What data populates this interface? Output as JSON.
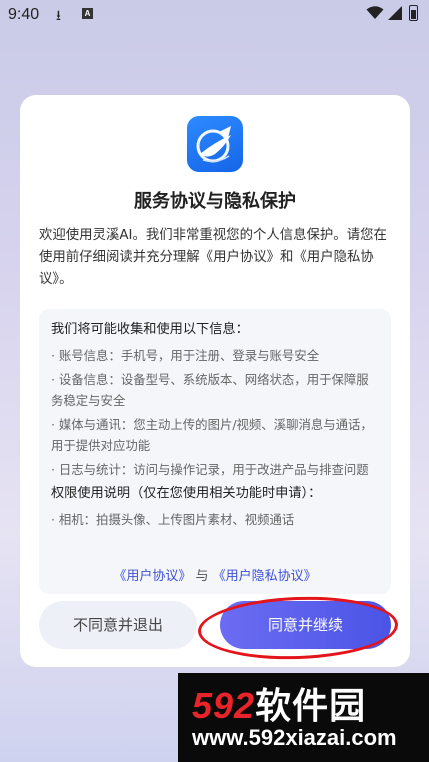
{
  "status_bar": {
    "time": "9:40",
    "indicator_letter": "A"
  },
  "dialog": {
    "title": "服务协议与隐私保护",
    "intro": "欢迎使用灵溪AI。我们非常重视您的个人信息保护。请您在使用前仔细阅读并充分理解《用户协议》和《用户隐私协议》。",
    "info_heading": "我们将可能收集和使用以下信息：",
    "info_items": [
      "· 账号信息：手机号，用于注册、登录与账号安全",
      "· 设备信息：设备型号、系统版本、网络状态，用于保障服务稳定与安全",
      "· 媒体与通讯：您主动上传的图片/视频、溪聊消息与通话，用于提供对应功能",
      "· 日志与统计：访问与操作记录，用于改进产品与排查问题"
    ],
    "permission_heading": "权限使用说明（仅在您使用相关功能时申请）：",
    "permission_items": [
      "· 相机：拍摄头像、上传图片素材、视频通话"
    ],
    "link_user_agreement": "《用户协议》",
    "link_separator": "与",
    "link_privacy_agreement": "《用户隐私协议》",
    "decline_button": "不同意并退出",
    "accept_button": "同意并继续"
  },
  "watermark": {
    "number": "592",
    "name": "软件园",
    "url": "www.592xiazai.com"
  },
  "colors": {
    "accent": "#4b54e6",
    "annotation": "#e3141a",
    "link": "#3d4fd6"
  }
}
